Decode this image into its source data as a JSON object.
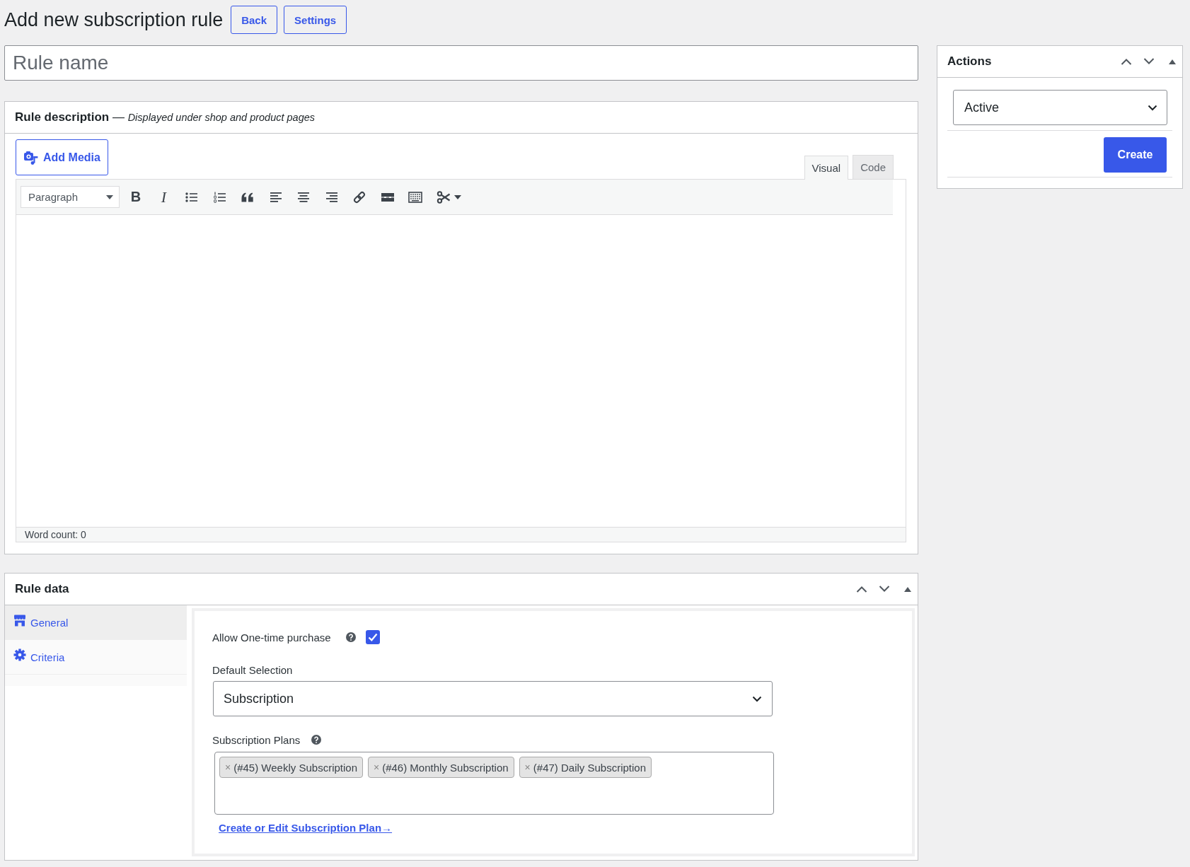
{
  "header": {
    "title": "Add new subscription rule",
    "buttons": [
      "Back",
      "Settings"
    ]
  },
  "rule_name": {
    "placeholder": "Rule name"
  },
  "rule_description": {
    "heading": "**Rule description** — *Displayed under shop and product pages*",
    "add_media": "Add Media",
    "editor_tabs": [
      {
        "label": "Visual",
        "selected": true
      },
      {
        "label": "Code",
        "selected": false
      }
    ],
    "format": "Paragraph",
    "toolbar": {
      "bold": "B",
      "italic": "I"
    },
    "word_count": "Word count: 0"
  },
  "rule_data": {
    "title": "Rule data",
    "tabs": [
      {
        "label": "General",
        "selected": true
      },
      {
        "label": "Criteria",
        "selected": false
      }
    ],
    "one_time_purchase": {
      "label": "Allow One-time purchase",
      "checked": true
    },
    "default_selection": {
      "label": "Default Selection",
      "value": "Subscription"
    },
    "subscription_plans": {
      "label": "Subscription Plans",
      "tags": [
        {
          "remove": "×",
          "label": "(#45) Weekly Subscription"
        },
        {
          "remove": "×",
          "label": "(#46) Monthly Subscription"
        },
        {
          "remove": "×",
          "label": "(#47) Daily Subscription"
        }
      ]
    },
    "link": "Create or Edit Subscription Plan→"
  },
  "actions": {
    "title": "Actions",
    "status": "Active",
    "button": "Create"
  }
}
